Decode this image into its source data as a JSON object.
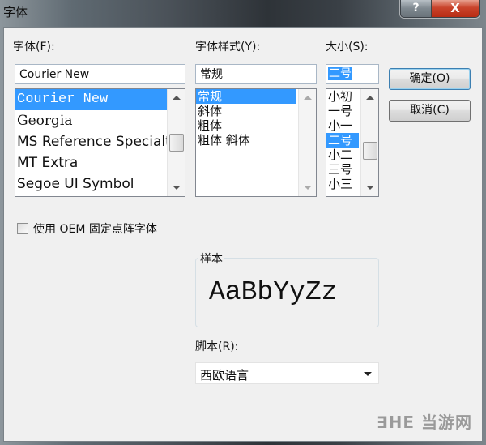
{
  "window": {
    "title": "字体",
    "help_label": "?",
    "close_label": "X"
  },
  "font": {
    "label": "字体(F):",
    "value": "Courier New",
    "items": [
      "Courier New",
      "Georgia",
      "MS Reference Specialty",
      "MT Extra",
      "Segoe UI Symbol"
    ],
    "selected_index": 0
  },
  "style": {
    "label": "字体样式(Y):",
    "value": "常规",
    "items": [
      "常规",
      "斜体",
      "粗体",
      "粗体 斜体"
    ],
    "selected_index": 0
  },
  "size": {
    "label": "大小(S):",
    "value": "二号",
    "items": [
      "小初",
      "一号",
      "小一",
      "二号",
      "小二",
      "三号",
      "小三"
    ],
    "selected_index": 3
  },
  "buttons": {
    "ok": "确定(O)",
    "cancel": "取消(C)"
  },
  "oem": {
    "label": "使用 OEM 固定点阵字体",
    "checked": false
  },
  "sample": {
    "label": "样本",
    "text": "AaBbYyZz"
  },
  "script": {
    "label": "脚本(R):",
    "value": "西欧语言"
  },
  "watermark": "∃HE 当游网"
}
